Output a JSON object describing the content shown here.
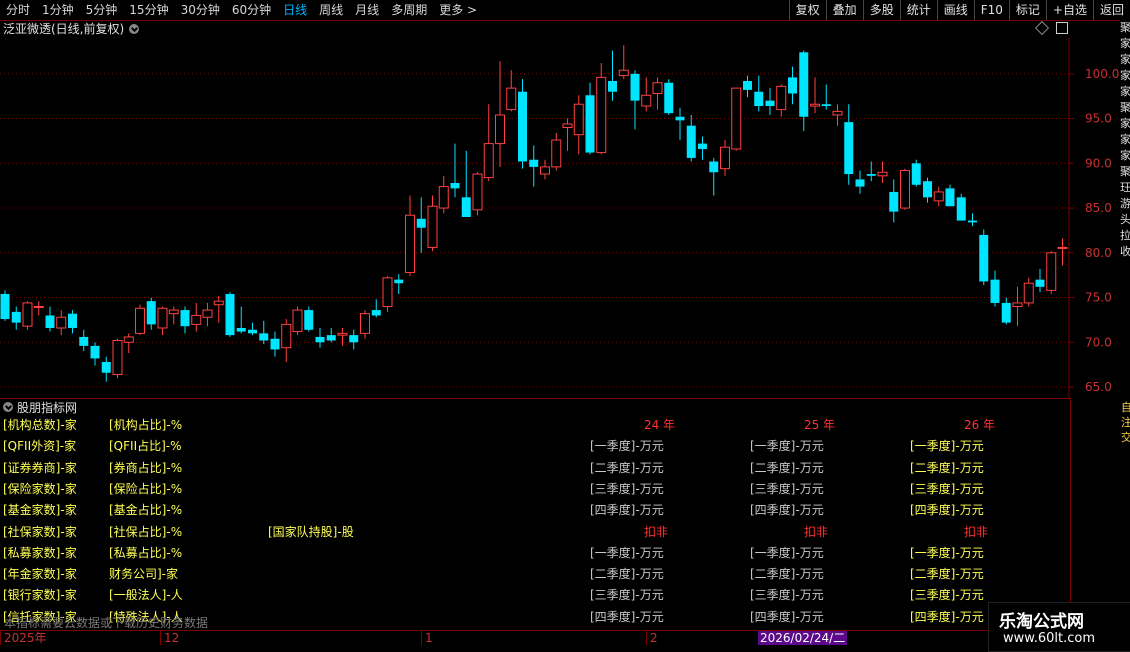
{
  "toolbar": {
    "timeframes": [
      "分时",
      "1分钟",
      "5分钟",
      "15分钟",
      "30分钟",
      "60分钟",
      "日线",
      "周线",
      "月线",
      "多周期",
      "更多 >"
    ],
    "selected": "日线",
    "actions": [
      "复权",
      "叠加",
      "多股",
      "统计",
      "画线",
      "F10",
      "标记",
      "+自选",
      "返回"
    ]
  },
  "chart": {
    "title": "泛亚微透(日线,前复权)",
    "side_labels": [
      "聚",
      "家",
      "家",
      "家",
      "家",
      "聚",
      "家",
      "家",
      "家",
      "聚",
      "玨",
      "游",
      "头",
      "拉",
      "收"
    ],
    "right_strip": [
      "自",
      "注",
      "交"
    ]
  },
  "colors": {
    "up": "#ff4040",
    "down": "#00e5ff",
    "grid": "#7a0000",
    "axis_text": "#c83030"
  },
  "chart_data": {
    "type": "candlestick",
    "yticks": [
      65.0,
      70.0,
      75.0,
      80.0,
      85.0,
      90.0,
      95.0,
      100.0
    ],
    "ylim": [
      64,
      104
    ],
    "candles": [
      {
        "o": 75.4,
        "h": 75.8,
        "l": 72.4,
        "c": 72.6
      },
      {
        "o": 73.4,
        "h": 74.0,
        "l": 71.4,
        "c": 72.2
      },
      {
        "o": 71.8,
        "h": 74.6,
        "l": 71.4,
        "c": 74.4
      },
      {
        "o": 74.0,
        "h": 74.6,
        "l": 73.0,
        "c": 74.0
      },
      {
        "o": 73.0,
        "h": 74.0,
        "l": 71.2,
        "c": 71.6
      },
      {
        "o": 71.6,
        "h": 73.6,
        "l": 70.8,
        "c": 72.8
      },
      {
        "o": 73.2,
        "h": 73.6,
        "l": 71.0,
        "c": 71.6
      },
      {
        "o": 70.6,
        "h": 71.4,
        "l": 69.0,
        "c": 69.6
      },
      {
        "o": 69.6,
        "h": 70.0,
        "l": 67.4,
        "c": 68.2
      },
      {
        "o": 67.8,
        "h": 68.4,
        "l": 65.6,
        "c": 66.6
      },
      {
        "o": 66.4,
        "h": 70.4,
        "l": 66.0,
        "c": 70.2
      },
      {
        "o": 70.0,
        "h": 71.0,
        "l": 68.8,
        "c": 70.6
      },
      {
        "o": 71.0,
        "h": 74.2,
        "l": 70.8,
        "c": 73.8
      },
      {
        "o": 74.6,
        "h": 75.0,
        "l": 71.4,
        "c": 72.0
      },
      {
        "o": 71.6,
        "h": 74.0,
        "l": 70.8,
        "c": 73.8
      },
      {
        "o": 73.2,
        "h": 74.0,
        "l": 72.0,
        "c": 73.6
      },
      {
        "o": 73.6,
        "h": 74.0,
        "l": 71.0,
        "c": 71.8
      },
      {
        "o": 72.0,
        "h": 74.4,
        "l": 71.2,
        "c": 73.0
      },
      {
        "o": 72.8,
        "h": 74.4,
        "l": 71.8,
        "c": 73.6
      },
      {
        "o": 74.2,
        "h": 75.2,
        "l": 72.2,
        "c": 74.6
      },
      {
        "o": 75.4,
        "h": 75.6,
        "l": 70.6,
        "c": 70.8
      },
      {
        "o": 71.6,
        "h": 74.0,
        "l": 71.0,
        "c": 71.2
      },
      {
        "o": 71.4,
        "h": 72.2,
        "l": 70.8,
        "c": 71.0
      },
      {
        "o": 71.0,
        "h": 72.4,
        "l": 69.8,
        "c": 70.2
      },
      {
        "o": 70.4,
        "h": 71.2,
        "l": 68.4,
        "c": 69.2
      },
      {
        "o": 69.4,
        "h": 72.6,
        "l": 67.8,
        "c": 72.0
      },
      {
        "o": 71.2,
        "h": 74.0,
        "l": 70.8,
        "c": 73.6
      },
      {
        "o": 73.6,
        "h": 74.0,
        "l": 71.2,
        "c": 71.4
      },
      {
        "o": 70.6,
        "h": 71.6,
        "l": 69.4,
        "c": 70.0
      },
      {
        "o": 70.8,
        "h": 71.6,
        "l": 70.0,
        "c": 70.2
      },
      {
        "o": 70.8,
        "h": 71.6,
        "l": 69.6,
        "c": 71.0
      },
      {
        "o": 70.8,
        "h": 71.4,
        "l": 69.2,
        "c": 70.0
      },
      {
        "o": 71.0,
        "h": 73.6,
        "l": 70.4,
        "c": 73.2
      },
      {
        "o": 73.6,
        "h": 74.8,
        "l": 72.8,
        "c": 73.0
      },
      {
        "o": 74.0,
        "h": 77.4,
        "l": 73.4,
        "c": 77.2
      },
      {
        "o": 77.0,
        "h": 77.6,
        "l": 75.4,
        "c": 76.6
      },
      {
        "o": 77.8,
        "h": 86.4,
        "l": 77.4,
        "c": 84.2
      },
      {
        "o": 83.8,
        "h": 86.2,
        "l": 80.0,
        "c": 82.8
      },
      {
        "o": 80.6,
        "h": 86.4,
        "l": 80.2,
        "c": 85.2
      },
      {
        "o": 85.0,
        "h": 88.6,
        "l": 84.4,
        "c": 87.4
      },
      {
        "o": 87.8,
        "h": 92.2,
        "l": 86.2,
        "c": 87.2
      },
      {
        "o": 86.2,
        "h": 91.4,
        "l": 84.0,
        "c": 84.0
      },
      {
        "o": 84.8,
        "h": 89.0,
        "l": 84.2,
        "c": 88.8
      },
      {
        "o": 88.4,
        "h": 96.6,
        "l": 88.0,
        "c": 92.2
      },
      {
        "o": 92.2,
        "h": 101.4,
        "l": 89.6,
        "c": 95.4
      },
      {
        "o": 96.0,
        "h": 100.4,
        "l": 95.8,
        "c": 98.4
      },
      {
        "o": 98.0,
        "h": 99.4,
        "l": 89.4,
        "c": 90.2
      },
      {
        "o": 90.4,
        "h": 92.0,
        "l": 87.4,
        "c": 89.6
      },
      {
        "o": 88.8,
        "h": 90.4,
        "l": 88.2,
        "c": 89.6
      },
      {
        "o": 89.6,
        "h": 93.4,
        "l": 89.2,
        "c": 92.6
      },
      {
        "o": 94.0,
        "h": 95.0,
        "l": 91.4,
        "c": 94.4
      },
      {
        "o": 93.2,
        "h": 97.6,
        "l": 91.0,
        "c": 96.6
      },
      {
        "o": 97.6,
        "h": 99.0,
        "l": 91.0,
        "c": 91.2
      },
      {
        "o": 91.2,
        "h": 101.2,
        "l": 91.0,
        "c": 99.6
      },
      {
        "o": 99.2,
        "h": 102.6,
        "l": 97.0,
        "c": 98.0
      },
      {
        "o": 99.8,
        "h": 103.2,
        "l": 99.4,
        "c": 100.4
      },
      {
        "o": 100.0,
        "h": 100.4,
        "l": 93.8,
        "c": 97.0
      },
      {
        "o": 96.4,
        "h": 99.6,
        "l": 95.8,
        "c": 97.6
      },
      {
        "o": 97.8,
        "h": 99.6,
        "l": 96.0,
        "c": 99.0
      },
      {
        "o": 99.0,
        "h": 99.4,
        "l": 95.4,
        "c": 95.6
      },
      {
        "o": 95.2,
        "h": 96.2,
        "l": 92.6,
        "c": 94.8
      },
      {
        "o": 94.2,
        "h": 95.4,
        "l": 90.2,
        "c": 90.6
      },
      {
        "o": 92.2,
        "h": 93.0,
        "l": 90.4,
        "c": 91.6
      },
      {
        "o": 90.2,
        "h": 90.6,
        "l": 86.4,
        "c": 89.0
      },
      {
        "o": 89.4,
        "h": 92.6,
        "l": 88.6,
        "c": 91.8
      },
      {
        "o": 91.6,
        "h": 98.4,
        "l": 91.4,
        "c": 98.4
      },
      {
        "o": 99.2,
        "h": 99.8,
        "l": 97.4,
        "c": 98.2
      },
      {
        "o": 98.0,
        "h": 99.8,
        "l": 95.8,
        "c": 96.4
      },
      {
        "o": 97.0,
        "h": 98.4,
        "l": 95.4,
        "c": 96.4
      },
      {
        "o": 96.0,
        "h": 98.8,
        "l": 95.2,
        "c": 98.6
      },
      {
        "o": 99.6,
        "h": 100.8,
        "l": 96.6,
        "c": 97.8
      },
      {
        "o": 102.4,
        "h": 102.6,
        "l": 93.6,
        "c": 95.2
      },
      {
        "o": 96.4,
        "h": 99.6,
        "l": 95.6,
        "c": 96.6
      },
      {
        "o": 96.6,
        "h": 98.8,
        "l": 96.0,
        "c": 96.4
      },
      {
        "o": 95.4,
        "h": 96.6,
        "l": 94.2,
        "c": 95.8
      },
      {
        "o": 94.6,
        "h": 96.6,
        "l": 87.6,
        "c": 88.8
      },
      {
        "o": 88.2,
        "h": 89.2,
        "l": 86.6,
        "c": 87.4
      },
      {
        "o": 88.8,
        "h": 90.2,
        "l": 88.0,
        "c": 88.6
      },
      {
        "o": 88.6,
        "h": 90.2,
        "l": 87.8,
        "c": 89.0
      },
      {
        "o": 86.8,
        "h": 88.2,
        "l": 83.4,
        "c": 84.6
      },
      {
        "o": 85.0,
        "h": 89.4,
        "l": 84.8,
        "c": 89.2
      },
      {
        "o": 90.0,
        "h": 90.4,
        "l": 87.4,
        "c": 87.6
      },
      {
        "o": 88.0,
        "h": 88.4,
        "l": 85.6,
        "c": 86.2
      },
      {
        "o": 85.8,
        "h": 87.4,
        "l": 85.2,
        "c": 86.8
      },
      {
        "o": 87.2,
        "h": 87.6,
        "l": 85.2,
        "c": 85.2
      },
      {
        "o": 86.2,
        "h": 86.6,
        "l": 83.6,
        "c": 83.6
      },
      {
        "o": 83.6,
        "h": 84.4,
        "l": 83.0,
        "c": 83.4
      },
      {
        "o": 82.0,
        "h": 82.6,
        "l": 76.4,
        "c": 76.8
      },
      {
        "o": 77.0,
        "h": 78.0,
        "l": 74.0,
        "c": 74.4
      },
      {
        "o": 74.4,
        "h": 75.0,
        "l": 72.0,
        "c": 72.2
      },
      {
        "o": 74.0,
        "h": 76.2,
        "l": 71.8,
        "c": 74.4
      },
      {
        "o": 74.4,
        "h": 77.2,
        "l": 74.0,
        "c": 76.6
      },
      {
        "o": 77.0,
        "h": 78.2,
        "l": 75.6,
        "c": 76.2
      },
      {
        "o": 75.8,
        "h": 80.2,
        "l": 75.4,
        "c": 80.0
      },
      {
        "o": 80.6,
        "h": 81.6,
        "l": 78.6,
        "c": 80.6
      }
    ]
  },
  "indicator": {
    "panel_title": "股朋指标网",
    "col1": [
      "[机构总数]-家",
      "[QFII外资]-家",
      "[证券券商]-家",
      "[保险家数]-家",
      "[基金家数]-家",
      "[社保家数]-家",
      "[私募家数]-家",
      "[年金家数]-家",
      "[银行家数]-家",
      "[信托家数]-家"
    ],
    "col2": [
      "[机构占比]-%",
      "[QFII占比]-%",
      "[券商占比]-%",
      "[保险占比]-%",
      "[基金占比]-%",
      "[社保占比]-%",
      "[私募占比]-%",
      "财务公司]-家",
      "[一般法人]-人",
      "[特殊法人]-人"
    ],
    "col3_special": "[国家队持股]-股",
    "years": [
      "24 年",
      "25 年",
      "26 年"
    ],
    "deduct_label": "扣非",
    "quarters": [
      "[一季度]-万元",
      "[二季度]-万元",
      "[三季度]-万元",
      "[四季度]-万元"
    ],
    "note": "本指标需要云数据或下载历史财务数据"
  },
  "date_axis": {
    "labels": [
      "2025年",
      "12",
      "1",
      "2"
    ],
    "highlight": "2026/02/24/二"
  },
  "watermark": {
    "name": "乐淘公式网",
    "url": "www.60lt.com"
  }
}
